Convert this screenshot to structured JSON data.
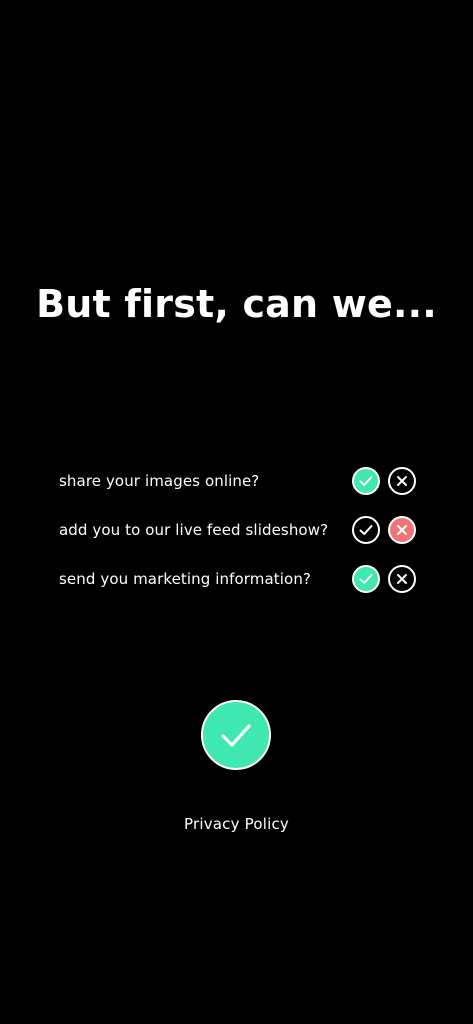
{
  "screen": {
    "title": "But first, can we..."
  },
  "consents": [
    {
      "label": "share your images online?",
      "selected": "yes"
    },
    {
      "label": "add you to our live feed slideshow?",
      "selected": "no"
    },
    {
      "label": "send you marketing information?",
      "selected": "yes"
    }
  ],
  "submit": {
    "icon": "check-icon"
  },
  "footer": {
    "privacy_label": "Privacy Policy"
  },
  "colors": {
    "background": "#000000",
    "accept": "#3ee8b0",
    "decline": "#f07474",
    "text": "#ffffff"
  }
}
